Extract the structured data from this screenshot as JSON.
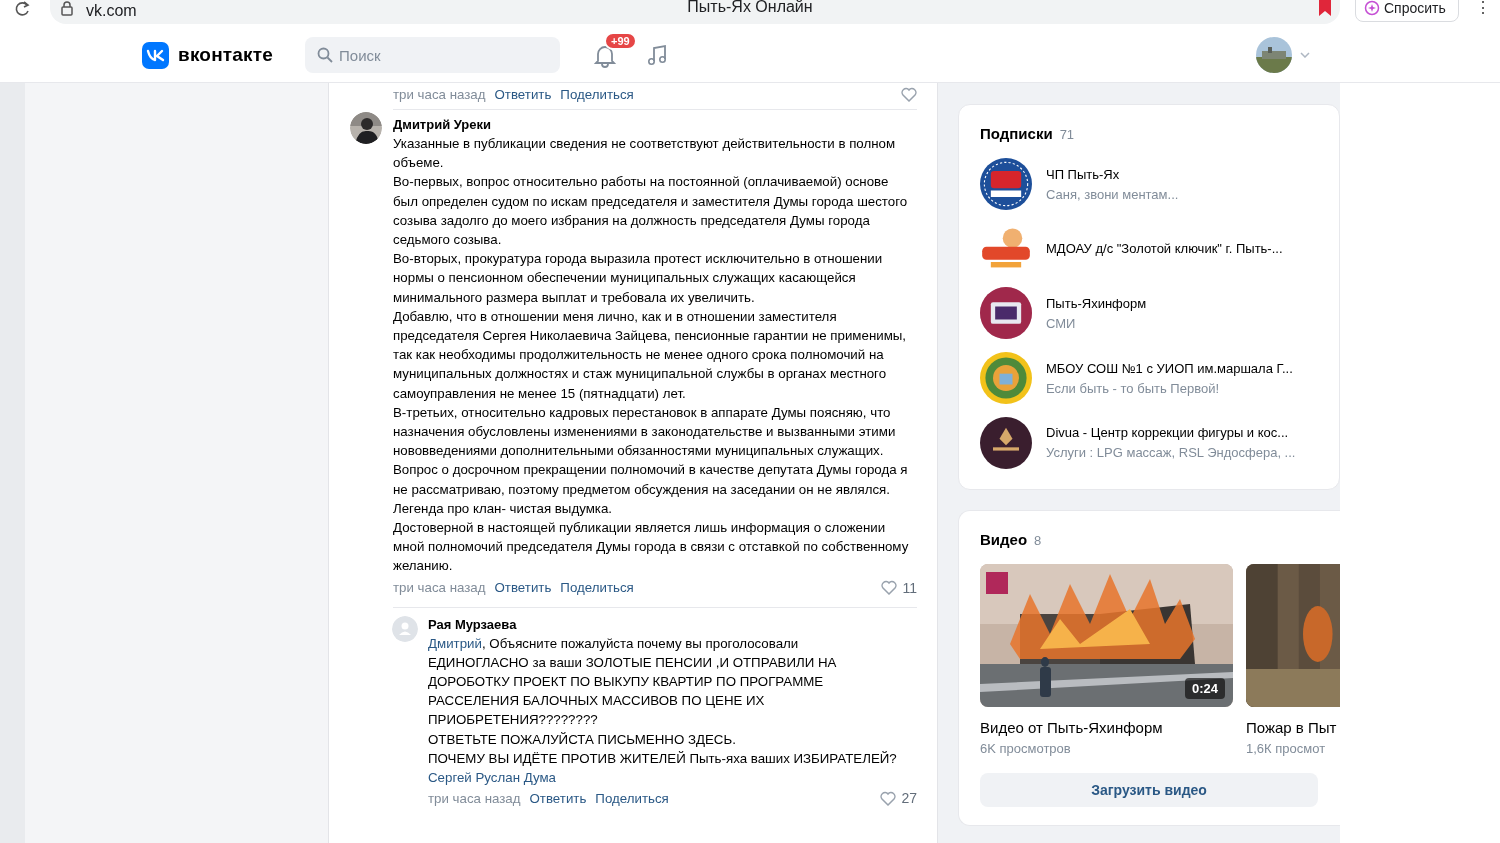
{
  "browser": {
    "address": "vk.com",
    "tab_title": "Пыть-Ях Онлайн",
    "ask_button": "Спросить",
    "menu": "⋮"
  },
  "header": {
    "logo_text": "вконтакте",
    "search": {
      "placeholder": "Поиск"
    },
    "notifications_badge": "+99"
  },
  "top_actions": {
    "time": "три часа назад",
    "reply": "Ответить",
    "share": "Поделиться"
  },
  "comments": [
    {
      "kind": "comment",
      "author": "Дмитрий Уреки",
      "paragraphs": [
        [
          {
            "kind": "text",
            "text": "Указанные в публикации сведения не соответствуют действительности в полном объеме."
          }
        ],
        [
          {
            "kind": "text",
            "text": "Во-первых, вопрос относительно работы на постоянной (оплачиваемой) основе был определен судом по искам председателя и заместителя Думы города шестого созыва задолго до моего избрания на должность председателя Думы города седьмого созыва."
          }
        ],
        [
          {
            "kind": "text",
            "text": "Во-вторых, прокуратура города выразила протест исключительно в отношении нормы о пенсионном обеспечении муниципальных служащих касающейся минимального размера выплат и требовала их увеличить."
          }
        ],
        [
          {
            "kind": "text",
            "text": "Добавлю, что в отношении меня лично, как и в отношении заместителя председателя Сергея Николаевича Зайцева, пенсионные гарантии не применимы, так как необходимы продолжительность не менее одного срока полномочий на муниципальных должностях и стаж муниципальной службы в органах местного самоуправления не менее 15 (пятнадцати) лет."
          }
        ],
        [
          {
            "kind": "text",
            "text": "В-третьих, относительно кадровых перестановок в аппарате Думы поясняю, что назначения обусловлены изменениями в законодательстве и вызванными этими нововведениями дополнительными обязанностями муниципальных служащих."
          }
        ],
        [
          {
            "kind": "text",
            "text": "Вопрос о досрочном прекращении полномочий в качестве депутата Думы города я не рассматриваю, поэтому предметом обсуждения на заседании он не являлся."
          }
        ],
        [
          {
            "kind": "text",
            "text": "Легенда про клан- чистая выдумка."
          }
        ],
        [
          {
            "kind": "text",
            "text": "Достоверной в настоящей публикации является лишь информация о сложении мной полномочий председателя Думы города в связи с отставкой по собственному желанию."
          }
        ]
      ],
      "time": "три часа назад",
      "reply": "Ответить",
      "share": "Поделиться",
      "likes": "11"
    },
    {
      "kind": "reply",
      "author": "Рая Мурзаева",
      "paragraphs": [
        [
          {
            "kind": "mention",
            "text": "Дмитрий"
          },
          {
            "kind": "text",
            "text": ", Объясните пожалуйста почему вы проголосовали ЕДИНОГЛАСНО за ваши ЗОЛОТЫЕ ПЕНСИИ ,И ОТПРАВИЛИ НА ДОРОБОТКУ ПРОЕКТ ПО ВЫКУПУ КВАРТИР ПО ПРОГРАММЕ РАССЕЛЕНИЯ БАЛОЧНЫХ МАССИВОВ ПО ЦЕНЕ ИХ ПРИОБРЕТЕНИЯ????????"
          }
        ],
        [
          {
            "kind": "text",
            "text": "ОТВЕТЬТЕ ПОЖАЛУЙСТА ПИСЬМЕННО ЗДЕСЬ."
          }
        ],
        [
          {
            "kind": "text",
            "text": "ПОЧЕМУ ВЫ ИДЁТЕ ПРОТИВ ЖИТЕЛЕЙ Пыть-яха ваших ИЗБИРАТЕЛЕЙ? "
          },
          {
            "kind": "mention",
            "text": "Сергей Руслан Дума"
          }
        ]
      ],
      "time": "три часа назад",
      "reply": "Ответить",
      "share": "Поделиться",
      "likes": "27"
    }
  ],
  "subscriptions": {
    "title": "Подписки",
    "count": "71",
    "items": [
      {
        "name": "ЧП Пыть-Ях",
        "subtitle": "Саня, звони ментам..."
      },
      {
        "name": "МДОАУ д/с \"Золотой ключик\" г. Пыть-..."
      },
      {
        "name": "Пыть-Яхинформ",
        "subtitle": "СМИ"
      },
      {
        "name": "МБОУ СОШ №1 с УИОП им.маршала Г...",
        "subtitle": "Если быть - то быть Первой!"
      },
      {
        "name": "Divua - Центр коррекции фигуры и кос...",
        "subtitle": "Услуги : LPG массаж, RSL Эндосфера, ..."
      }
    ]
  },
  "videos": {
    "title": "Видео",
    "count": "8",
    "items": [
      {
        "title": "Видео от Пыть-Яхинформ",
        "views": "6K просмотров",
        "duration": "0:24"
      },
      {
        "title": "Пожар в Пыт",
        "views": "1,6К просмот"
      }
    ],
    "upload_button": "Загрузить видео"
  }
}
